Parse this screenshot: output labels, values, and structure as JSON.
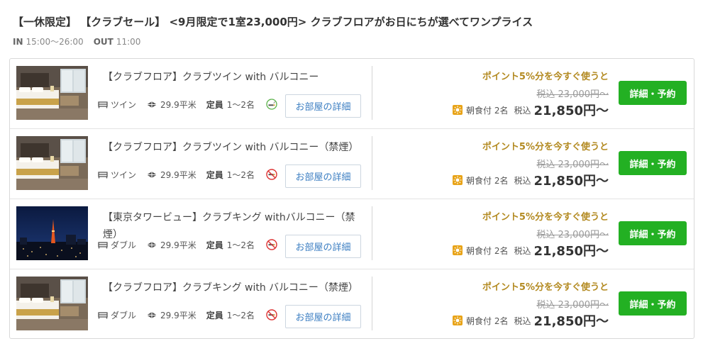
{
  "plan": {
    "title": "【一休限定】 【クラブセール】 <9月限定で1室23,000円> クラブフロアがお日にちが選べてワンプライス",
    "in_label": "IN",
    "in_time": "15:00〜26:00",
    "out_label": "OUT",
    "out_time": "11:00"
  },
  "rooms": [
    {
      "name": "【クラブフロア】クラブツイン with バルコニー",
      "photo": "hotel-room-photo",
      "bed": "ツイン",
      "bed_icon": "bed-icon",
      "size": "29.9平米",
      "capacity_label": "定員",
      "capacity": "1〜2名",
      "smoking_icon": "smoking-allowed-icon",
      "detail_label": "お部屋の詳細",
      "point_msg": "ポイント5%分を今すぐ使うと",
      "original_price": "税込 23,000円〜",
      "meal": "朝食付",
      "persons": "2名",
      "tax_label": "税込",
      "price": "21,850円〜",
      "book_label": "詳細・予約"
    },
    {
      "name": "【クラブフロア】クラブツイン with バルコニー（禁煙）",
      "photo": "hotel-room-photo",
      "bed": "ツイン",
      "bed_icon": "bed-icon",
      "size": "29.9平米",
      "capacity_label": "定員",
      "capacity": "1〜2名",
      "smoking_icon": "no-smoking-icon",
      "detail_label": "お部屋の詳細",
      "point_msg": "ポイント5%分を今すぐ使うと",
      "original_price": "税込 23,000円〜",
      "meal": "朝食付",
      "persons": "2名",
      "tax_label": "税込",
      "price": "21,850円〜",
      "book_label": "詳細・予約"
    },
    {
      "name": "【東京タワービュー】クラブキング withバルコニー（禁煙）",
      "photo": "tokyo-tower-night-photo",
      "bed": "ダブル",
      "bed_icon": "bed-icon",
      "size": "29.9平米",
      "capacity_label": "定員",
      "capacity": "1〜2名",
      "smoking_icon": "no-smoking-icon",
      "detail_label": "お部屋の詳細",
      "point_msg": "ポイント5%分を今すぐ使うと",
      "original_price": "税込 23,000円〜",
      "meal": "朝食付",
      "persons": "2名",
      "tax_label": "税込",
      "price": "21,850円〜",
      "book_label": "詳細・予約"
    },
    {
      "name": "【クラブフロア】クラブキング with バルコニー（禁煙）",
      "photo": "hotel-room-photo",
      "bed": "ダブル",
      "bed_icon": "bed-icon",
      "size": "29.9平米",
      "capacity_label": "定員",
      "capacity": "1〜2名",
      "smoking_icon": "no-smoking-icon",
      "detail_label": "お部屋の詳細",
      "point_msg": "ポイント5%分を今すぐ使うと",
      "original_price": "税込 23,000円〜",
      "meal": "朝食付",
      "persons": "2名",
      "tax_label": "税込",
      "price": "21,850円〜",
      "book_label": "詳細・予約"
    }
  ],
  "colors": {
    "accent_gold": "#b38a21",
    "book_green": "#23b023",
    "link_blue": "#3b7ec2",
    "meal_orange": "#e8a317"
  }
}
